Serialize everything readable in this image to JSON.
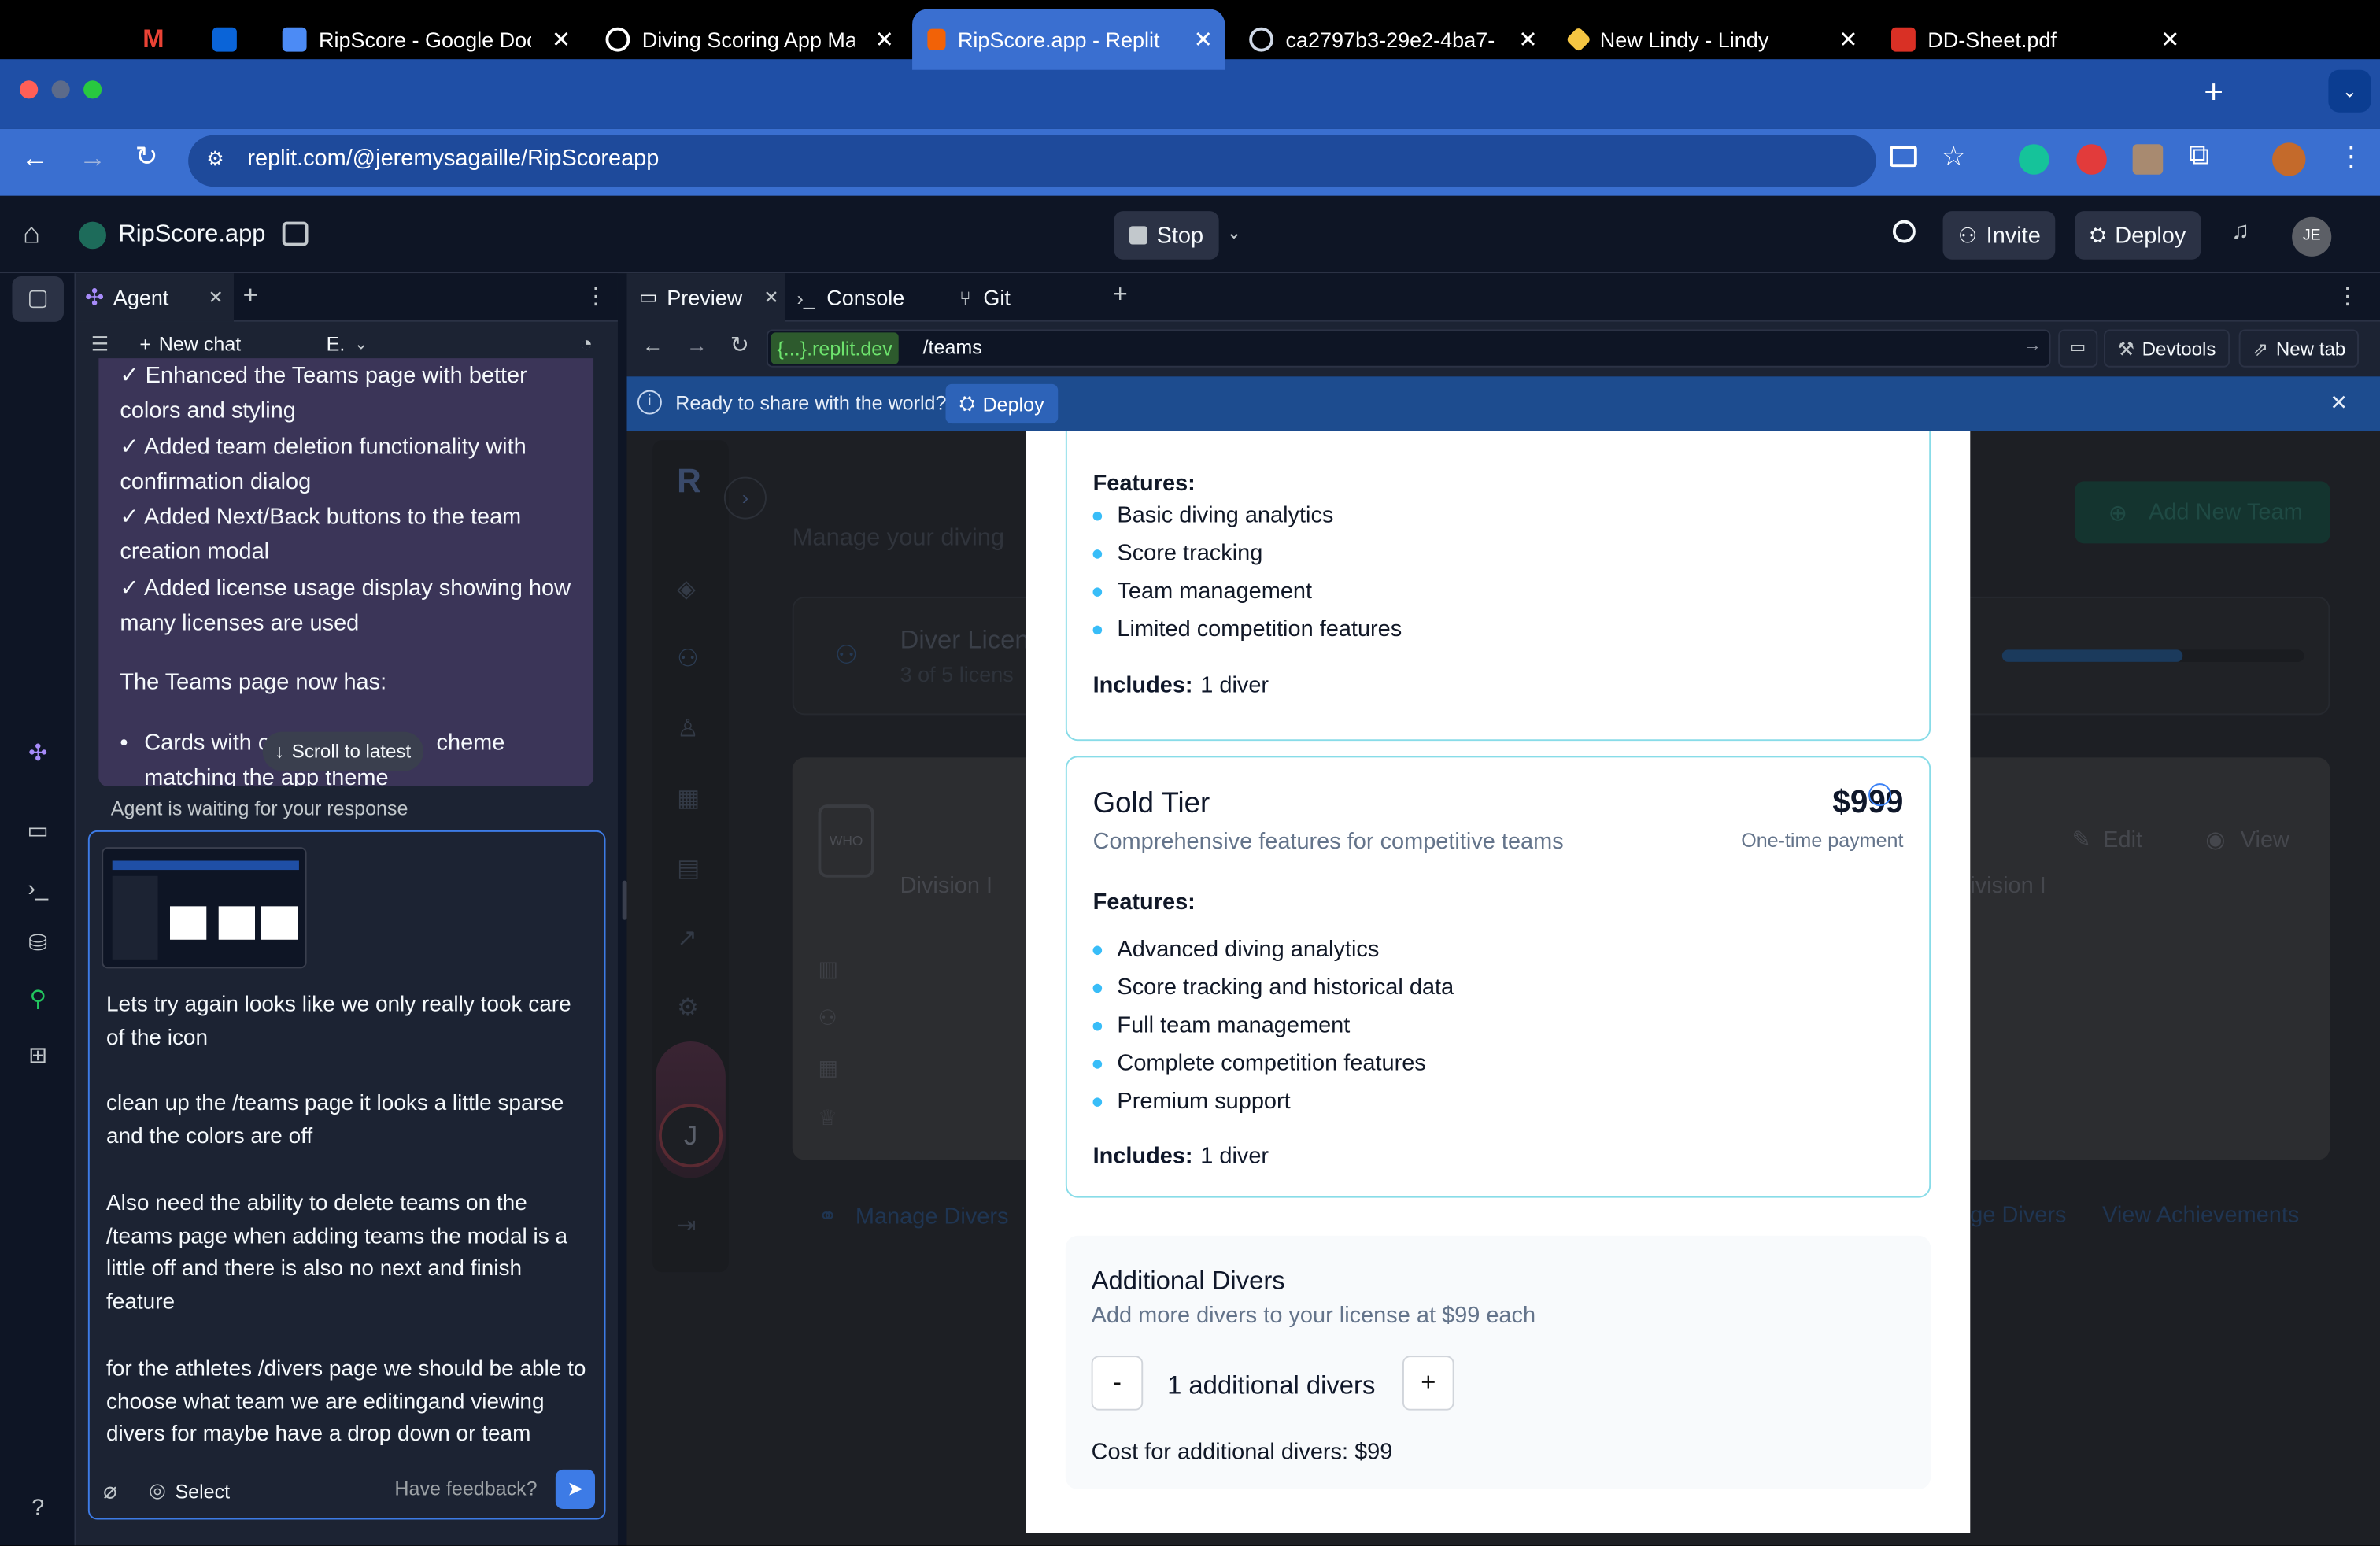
{
  "browser": {
    "tabs": [
      {
        "label": "",
        "icon": "gmail-icon"
      },
      {
        "label": "",
        "icon": "outlook-icon"
      },
      {
        "label": "RipScore - Google Docs",
        "icon": "google-docs-icon"
      },
      {
        "label": "Diving Scoring App Mar",
        "icon": "chatgpt-icon"
      },
      {
        "label": "RipScore.app - Replit",
        "icon": "replit-icon",
        "active": true
      },
      {
        "label": "ca2797b3-29e2-4ba7-",
        "icon": "globe-icon"
      },
      {
        "label": "New Lindy - Lindy",
        "icon": "lindy-icon"
      },
      {
        "label": "DD-Sheet.pdf",
        "icon": "pdf-icon"
      }
    ],
    "url": "replit.com/@jeremysagaille/RipScoreapp"
  },
  "header": {
    "project_name": "RipScore.app",
    "stop_label": "Stop",
    "invite_label": "Invite",
    "deploy_label": "Deploy",
    "avatar_initials": "JE"
  },
  "agent": {
    "tab_label": "Agent",
    "new_chat_label": "New chat",
    "model_short": "E.",
    "messages": [
      "✓ Enhanced the Teams page with better colors and styling",
      "✓ Added team deletion functionality with confirmation dialog",
      "✓ Added Next/Back buttons to the team creation modal",
      "✓ Added license usage display showing how many licenses are used"
    ],
    "teams_heading": "The Teams page now has:",
    "bullet_start": "Cards with c",
    "bullet_end": "cheme",
    "bullet_line2": "matching the app theme",
    "scroll_label": "Scroll to latest",
    "waiting_text": "Agent is waiting for your response",
    "input_text": "Lets try again looks like we only really took care of the icon\n\nclean up the /teams page it looks a little sparse and the colors are off\n\nAlso need the ability to delete teams on the /teams page when adding teams the modal is a little off and there is also no next and finish feature\n\nfor the athletes /divers page we should be able to choose what team we are editingand viewing divers for maybe have a drop down or team",
    "select_label": "Select",
    "feedback_label": "Have feedback?"
  },
  "preview": {
    "tabs": [
      {
        "label": "Preview"
      },
      {
        "label": "Console"
      },
      {
        "label": "Git"
      }
    ],
    "domain_label": "{...}.replit.dev",
    "path": "/teams",
    "devtools_label": "Devtools",
    "newtab_label": "New tab",
    "banner_text": "Ready to share with the world?",
    "banner_deploy": "Deploy"
  },
  "background_app": {
    "logo_letter": "R",
    "subtitle": "Manage your diving",
    "add_team_label": "Add New Team",
    "license_title": "Diver Licen",
    "license_sub": "3 of 5 licens",
    "license_progress": 0.6,
    "division_left": "Division I",
    "division_right": "ivision I",
    "edit_label": "Edit",
    "view_label": "View",
    "who_label": "WHO",
    "manage_divers": "Manage Divers",
    "manage_divers_right": "ge Divers",
    "view_achievements": "View Achievements",
    "user_initial": "J"
  },
  "modal": {
    "basic": {
      "features_label": "Features:",
      "features": [
        "Basic diving analytics",
        "Score tracking",
        "Team management",
        "Limited competition features"
      ],
      "includes_label": "Includes:",
      "includes_value": "1 diver"
    },
    "gold": {
      "title": "Gold Tier",
      "subtitle": "Comprehensive features for competitive teams",
      "price": "$999",
      "price_note": "One-time payment",
      "features_label": "Features:",
      "features": [
        "Advanced diving analytics",
        "Score tracking and historical data",
        "Full team management",
        "Complete competition features",
        "Premium support"
      ],
      "includes_label": "Includes:",
      "includes_value": "1 diver"
    },
    "additional": {
      "title": "Additional Divers",
      "subtitle": "Add more divers to your license at $99 each",
      "minus": "-",
      "plus": "+",
      "count_text": "1 additional divers",
      "cost_text": "Cost for additional divers: $99"
    }
  },
  "colors": {
    "tabbar": "#1f4fa6",
    "accent_blue": "#3d7be6",
    "card_border": "#88dce8",
    "bullet": "#38bdf8"
  }
}
